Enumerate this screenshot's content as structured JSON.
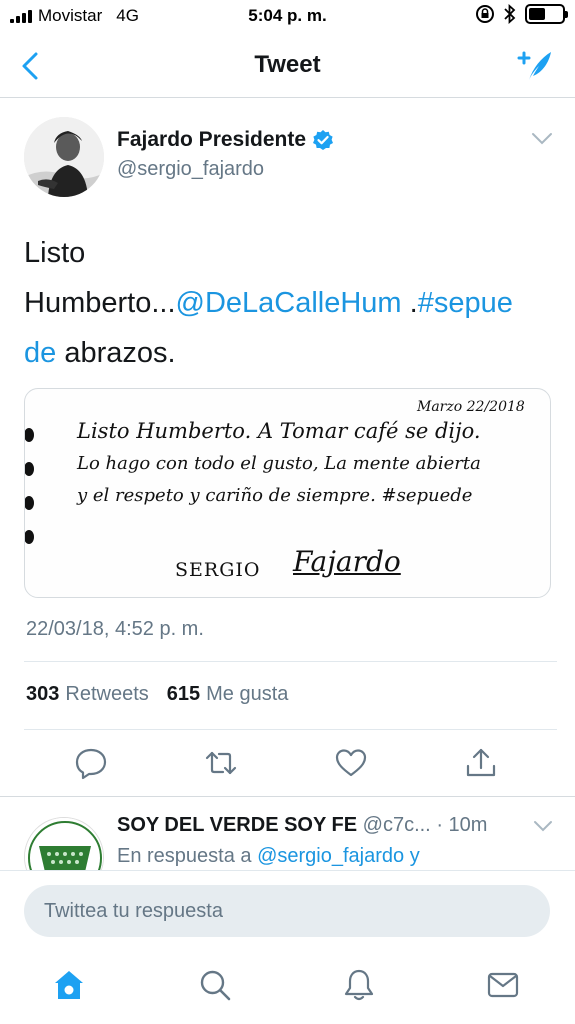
{
  "status_bar": {
    "carrier": "Movistar",
    "network": "4G",
    "time": "5:04 p. m.",
    "battery_level": 0.5
  },
  "nav": {
    "title": "Tweet",
    "back_icon": "chevron-left-icon",
    "compose_icon": "compose-tweet-icon"
  },
  "tweet": {
    "author_name": "Fajardo Presidente",
    "author_handle": "@sergio_fajardo",
    "verified": true,
    "text_parts": {
      "line1": "Listo",
      "line2_plain": "Humberto...",
      "mention": "@DeLaCalleHum",
      "sep": " .",
      "hashtag_part1": "#sepue",
      "hashtag_part2": "de",
      "line3_plain": " abrazos."
    },
    "media": {
      "date": "Marzo 22/2018",
      "lines": [
        "Listo Humberto. A Tomar café se dijo.",
        "Lo hago con todo el gusto, La mente abierta",
        "y el respeto y cariño de siempre. #sepuede"
      ],
      "signature_name": "SERGIO",
      "signature": "Fajardo"
    },
    "timestamp": "22/03/18, 4:52 p. m.",
    "retweets_count": "303",
    "retweets_label": "Retweets",
    "likes_count": "615",
    "likes_label": "Me gusta"
  },
  "actions": [
    "reply-icon",
    "retweet-icon",
    "like-icon",
    "share-icon"
  ],
  "reply": {
    "name": "SOY DEL VERDE SOY FE",
    "handle": "@c7c...",
    "time": "· 10m",
    "in_reply_prefix": "En respuesta a",
    "in_reply_handle": "@sergio_fajardo y"
  },
  "composer": {
    "placeholder": "Twittea tu respuesta"
  },
  "tab_bar": [
    "home-icon",
    "search-icon",
    "notifications-icon",
    "messages-icon"
  ],
  "colors": {
    "accent": "#1da1f2",
    "link": "#1b95e0",
    "text_primary": "#14171a",
    "text_secondary": "#657786"
  }
}
